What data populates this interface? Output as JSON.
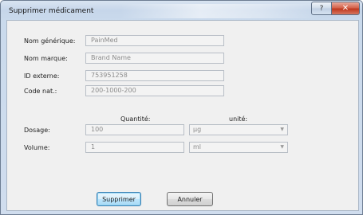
{
  "window": {
    "title": "Supprimer médicament",
    "help_glyph": "?",
    "close_glyph": "✕"
  },
  "form": {
    "generic_name": {
      "label": "Nom générique:",
      "value": "PainMed"
    },
    "brand_name": {
      "label": "Nom marque:",
      "value": "Brand Name"
    },
    "external_id": {
      "label": "ID externe:",
      "value": "753951258"
    },
    "nat_code": {
      "label": "Code nat.:",
      "value": "200-1000-200"
    }
  },
  "quantities": {
    "quantity_header": "Quantité:",
    "unit_header": "unité:",
    "dosage": {
      "label": "Dosage:",
      "value": "100",
      "unit": "µg"
    },
    "volume": {
      "label": "Volume:",
      "value": "1",
      "unit": "ml"
    },
    "dropdown_arrow": "▼"
  },
  "buttons": {
    "delete": "Supprimer",
    "cancel": "Annuler"
  }
}
